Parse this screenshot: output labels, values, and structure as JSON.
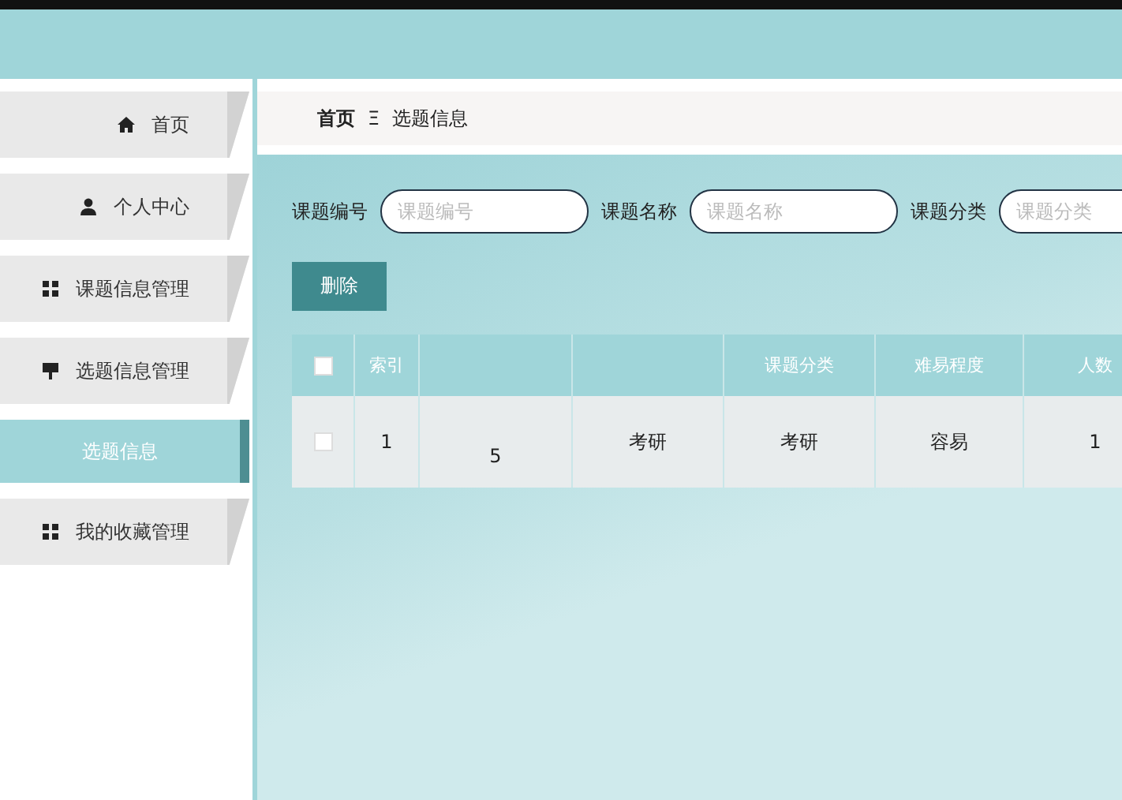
{
  "sidebar": {
    "items": [
      {
        "label": "首页",
        "kind": "home",
        "selected": false
      },
      {
        "label": "个人中心",
        "kind": "user",
        "selected": false
      },
      {
        "label": "课题信息管理",
        "kind": "module",
        "selected": false
      },
      {
        "label": "选题信息管理",
        "kind": "board",
        "selected": false
      },
      {
        "label": "选题信息",
        "kind": "submenu",
        "selected": true
      },
      {
        "label": "我的收藏管理",
        "kind": "module",
        "selected": false
      }
    ]
  },
  "breadcrumb": {
    "items": [
      "首页",
      "选题信息"
    ],
    "separator": "Ξ"
  },
  "search": {
    "fields": [
      {
        "label": "课题编号",
        "placeholder": "课题编号"
      },
      {
        "label": "课题名称",
        "placeholder": "课题名称"
      },
      {
        "label": "课题分类",
        "placeholder": "课题分类"
      }
    ]
  },
  "delete_button": "删除",
  "table": {
    "select_all_checked": false,
    "columns": [
      "索引",
      "",
      "",
      "课题分类",
      "难易程度",
      "人数"
    ],
    "rows": [
      {
        "checked": false,
        "cells": [
          "1",
          "5",
          "考研",
          "考研",
          "容易",
          "1"
        ]
      }
    ]
  }
}
